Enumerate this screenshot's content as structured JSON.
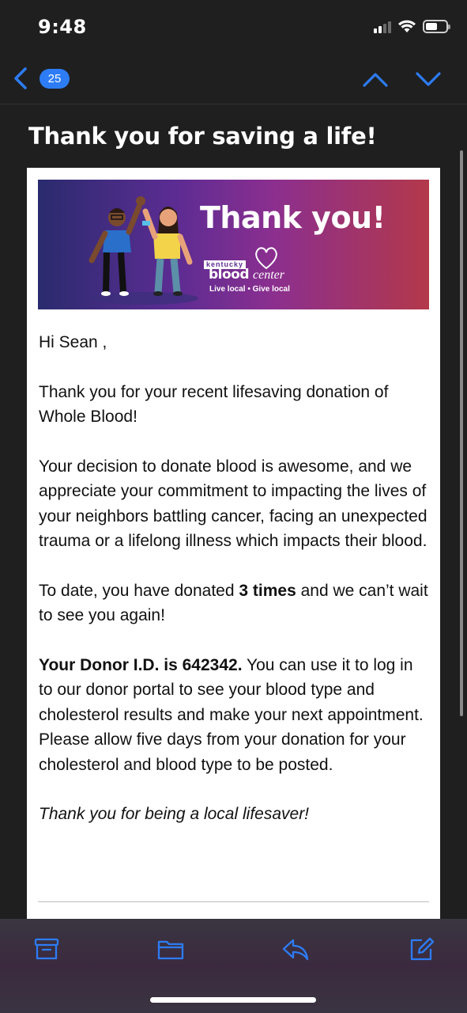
{
  "status_bar": {
    "time": "9:48",
    "signal_icon": "cellular-signal-icon",
    "wifi_icon": "wifi-icon",
    "battery_icon": "battery-icon"
  },
  "nav": {
    "back_icon": "chevron-left-icon",
    "unread_count": "25",
    "prev_icon": "chevron-up-icon",
    "next_icon": "chevron-down-icon",
    "accent_color": "#2d7cf6"
  },
  "email": {
    "subject": "Thank you for saving a life!",
    "banner": {
      "title": "Thank you!",
      "logo_kentucky": "kentucky",
      "logo_blood": "blood",
      "logo_center": "center",
      "tagline": "Live local • Give local"
    },
    "greeting": "Hi Sean ,",
    "para1": "Thank you for your recent lifesaving donation of Whole Blood!",
    "para2": "Your decision to donate blood is awesome, and we appreciate your commitment to impacting the lives of your neighbors battling cancer, facing an unexpected trauma or a lifelong illness which impacts their blood.",
    "para3_prefix": "To date, you have donated ",
    "para3_bold": "3 times",
    "para3_suffix": " and we can’t wait to see you again!",
    "para4_bold": "Your Donor I.D. is 642342.",
    "para4_rest": " You can use it to log in to our donor portal to see your blood type and cholesterol results and make your next appointment. Please allow five days from your donation for your cholesterol and blood type to be posted.",
    "closing": "Thank you for being a local lifesaver!"
  },
  "toolbar": {
    "archive_icon": "archive-icon",
    "folder_icon": "folder-icon",
    "reply_icon": "reply-icon",
    "compose_icon": "compose-icon"
  }
}
